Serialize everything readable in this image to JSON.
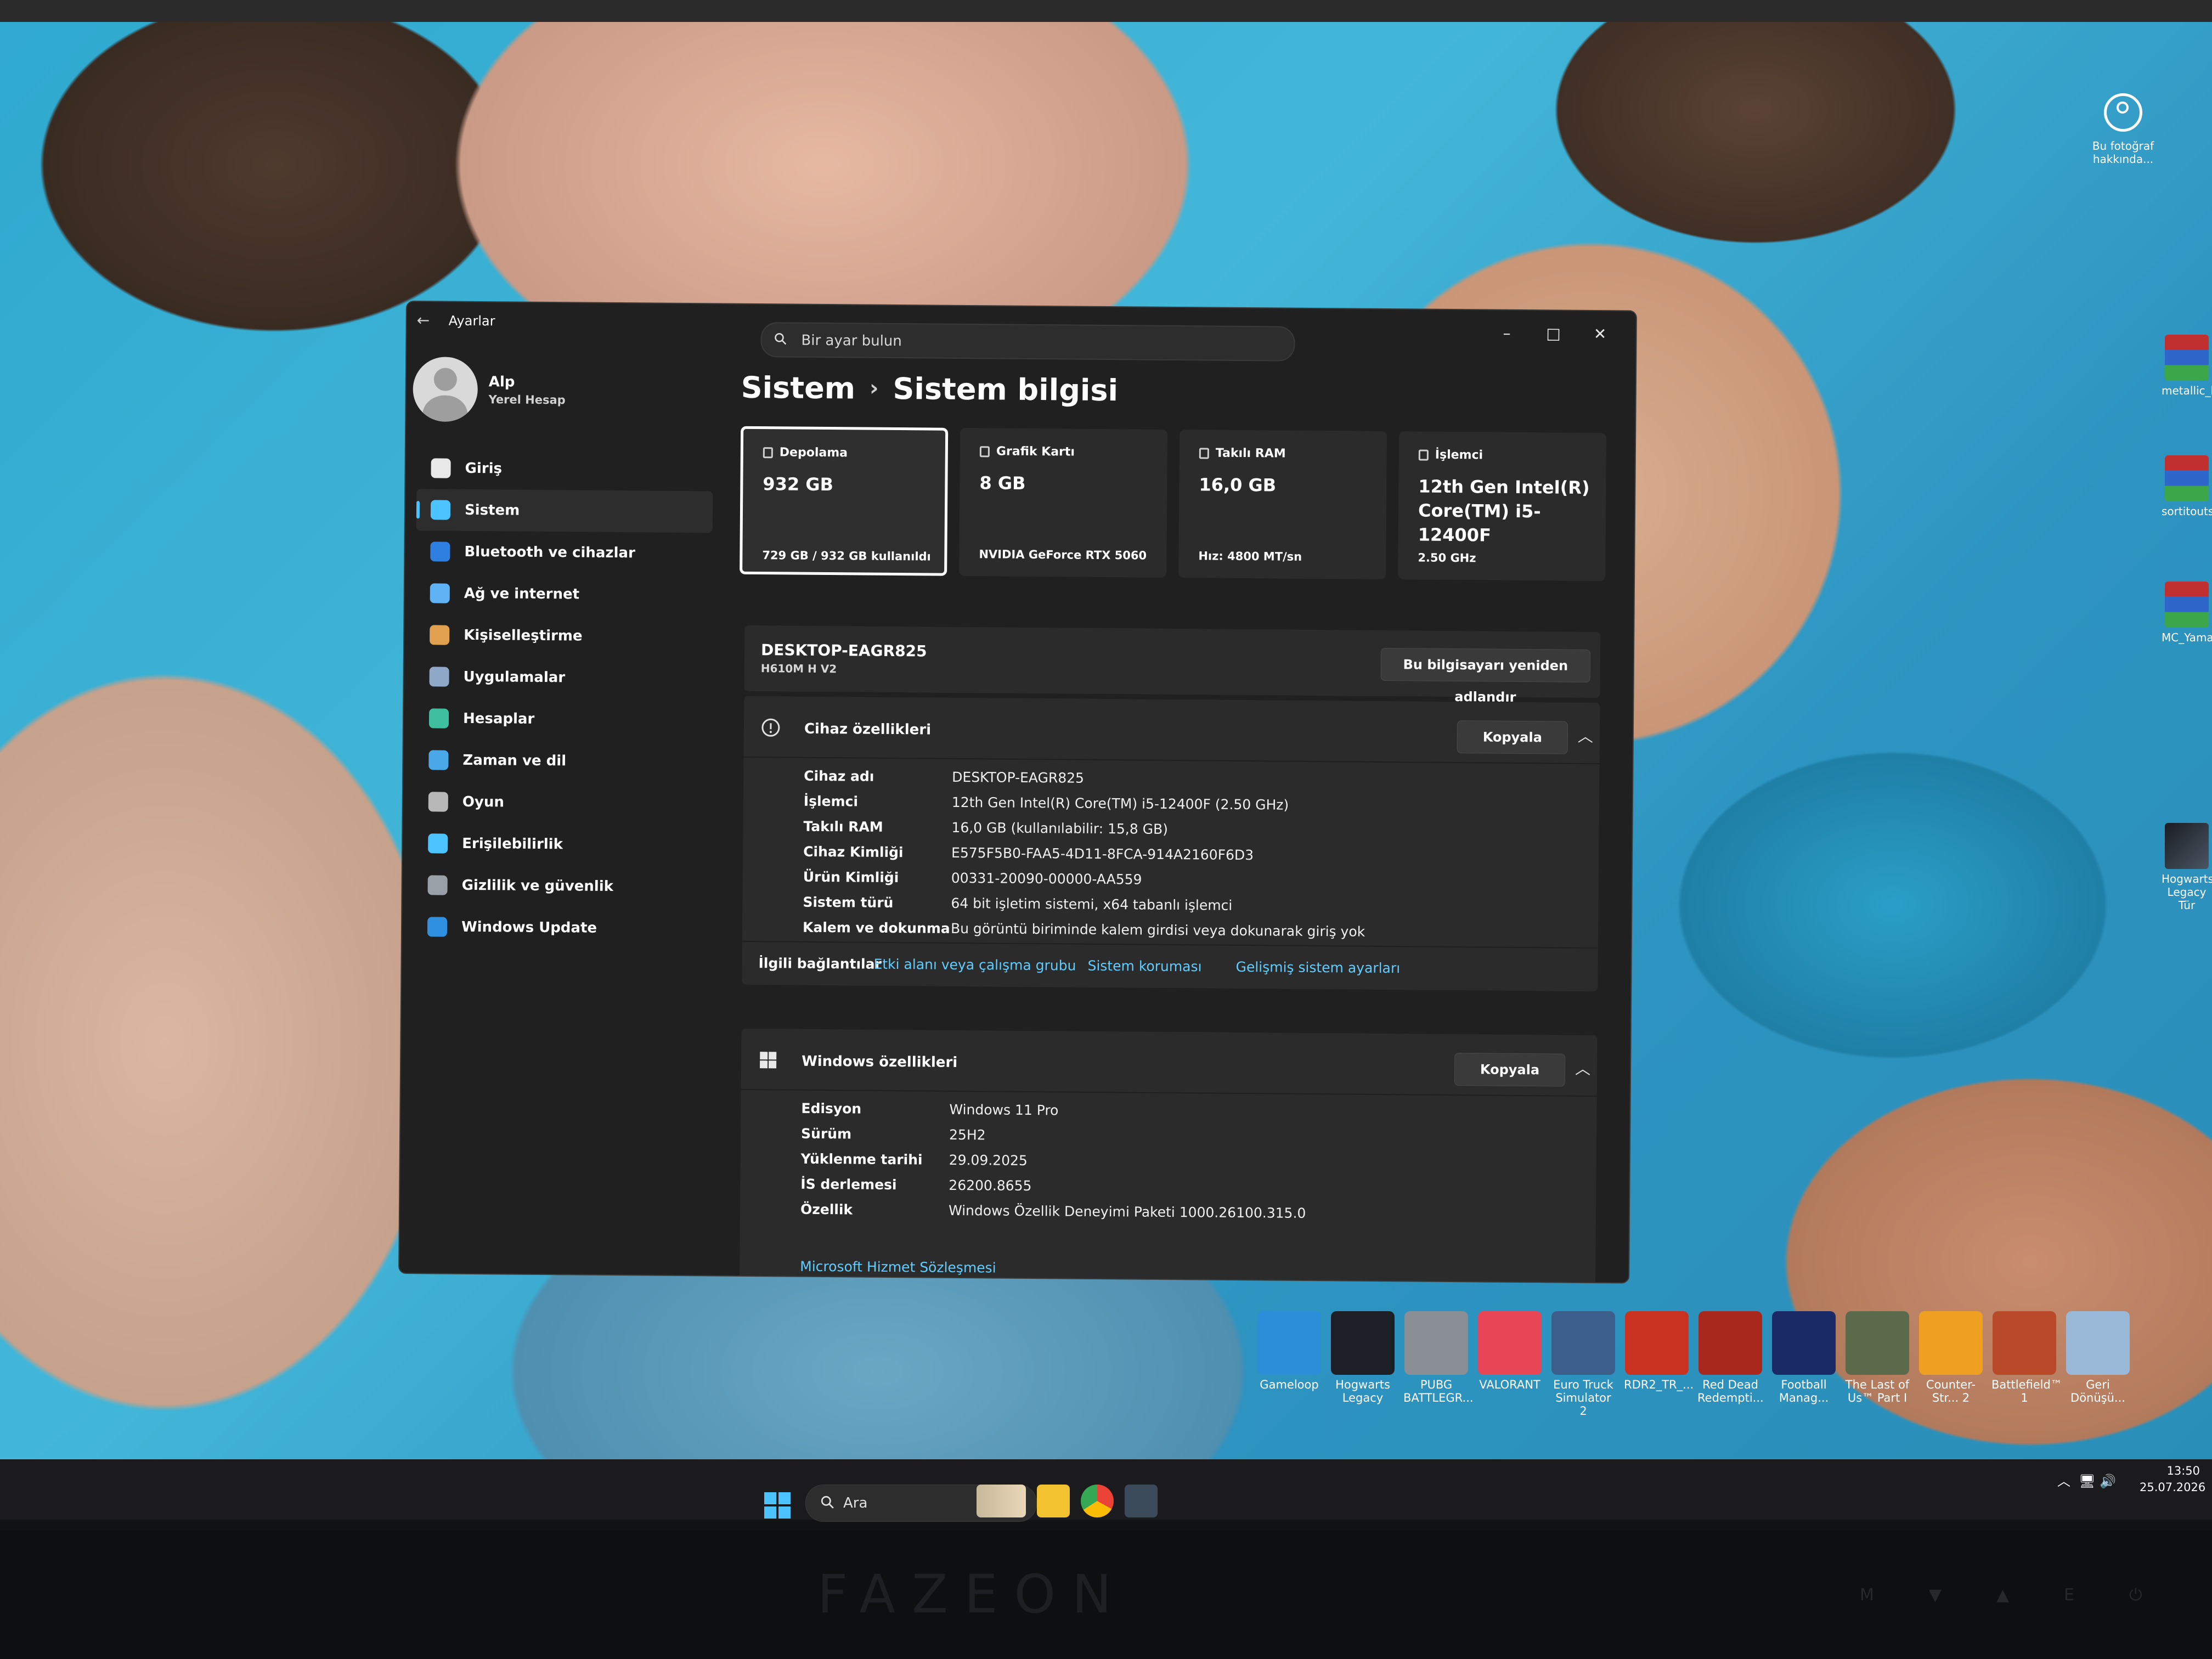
{
  "photo_credit": {
    "label_line1": "Bu fotoğraf",
    "label_line2": "hakkında..."
  },
  "side_icons": [
    {
      "label": "metallic_l",
      "icon": "winrar-archive-icon"
    },
    {
      "label": "sortitouts",
      "icon": "winrar-archive-icon"
    },
    {
      "label": "MC_Yama",
      "icon": "winrar-archive-icon"
    },
    {
      "label": "Hogwarts Legacy Tür",
      "icon": "hogwarts-legacy-icon"
    }
  ],
  "window": {
    "app_title": "Ayarlar",
    "search_placeholder": "Bir ayar bulun",
    "user": {
      "name": "Alp",
      "type": "Yerel Hesap"
    },
    "nav": [
      {
        "label": "Giriş",
        "icon": "home-icon",
        "color": "#e8e8e8",
        "active": false
      },
      {
        "label": "Sistem",
        "icon": "system-monitor-icon",
        "color": "#4cc2ff",
        "active": true
      },
      {
        "label": "Bluetooth ve cihazlar",
        "icon": "bluetooth-icon",
        "color": "#2f7fe0",
        "active": false
      },
      {
        "label": "Ağ ve internet",
        "icon": "wifi-icon",
        "color": "#5fb3f5",
        "active": false
      },
      {
        "label": "Kişiselleştirme",
        "icon": "brush-icon",
        "color": "#e0a050",
        "active": false
      },
      {
        "label": "Uygulamalar",
        "icon": "apps-icon",
        "color": "#8fa8c8",
        "active": false
      },
      {
        "label": "Hesaplar",
        "icon": "person-icon",
        "color": "#3fbf9f",
        "active": false
      },
      {
        "label": "Zaman ve dil",
        "icon": "globe-clock-icon",
        "color": "#4aa8e8",
        "active": false
      },
      {
        "label": "Oyun",
        "icon": "gamepad-icon",
        "color": "#b8b8b8",
        "active": false
      },
      {
        "label": "Erişilebilirlik",
        "icon": "accessibility-icon",
        "color": "#4cc2ff",
        "active": false
      },
      {
        "label": "Gizlilik ve güvenlik",
        "icon": "shield-icon",
        "color": "#9aa0a8",
        "active": false
      },
      {
        "label": "Windows Update",
        "icon": "update-icon",
        "color": "#2f8fe0",
        "active": false
      }
    ],
    "breadcrumb": {
      "parent": "Sistem",
      "current": "Sistem bilgisi"
    },
    "cards": [
      {
        "title": "Depolama",
        "value": "932 GB",
        "sub": "729 GB / 932 GB kullanıldı",
        "icon": "storage-icon",
        "selected": true
      },
      {
        "title": "Grafik Kartı",
        "value": "8 GB",
        "sub": "NVIDIA GeForce RTX 5060",
        "icon": "gpu-icon",
        "selected": false
      },
      {
        "title": "Takılı RAM",
        "value": "16,0 GB",
        "sub": "Hız: 4800 MT/sn",
        "icon": "ram-icon",
        "selected": false
      },
      {
        "title": "İşlemci",
        "value": "12th Gen Intel(R) Core(TM) i5-12400F",
        "sub": "2.50 GHz",
        "icon": "cpu-icon",
        "selected": false
      }
    ],
    "device": {
      "name": "DESKTOP-EAGR825",
      "model": "H610M H V2",
      "rename_label": "Bu bilgisayarı yeniden adlandır"
    },
    "device_specs": {
      "title": "Cihaz özellikleri",
      "copy_label": "Kopyala",
      "rows": [
        {
          "key": "Cihaz adı",
          "value": "DESKTOP-EAGR825"
        },
        {
          "key": "İşlemci",
          "value": "12th Gen Intel(R) Core(TM) i5-12400F (2.50 GHz)"
        },
        {
          "key": "Takılı RAM",
          "value": "16,0 GB (kullanılabilir: 15,8 GB)"
        },
        {
          "key": "Cihaz Kimliği",
          "value": "E575F5B0-FAA5-4D11-8FCA-914A2160F6D3"
        },
        {
          "key": "Ürün Kimliği",
          "value": "00331-20090-00000-AA559"
        },
        {
          "key": "Sistem türü",
          "value": "64 bit işletim sistemi, x64 tabanlı işlemci"
        },
        {
          "key": "Kalem ve dokunma",
          "value": "Bu görüntü biriminde kalem girdisi veya dokunarak giriş yok"
        }
      ],
      "related_label": "İlgili bağlantılar",
      "related_links": [
        "Etki alanı veya çalışma grubu",
        "Sistem koruması",
        "Gelişmiş sistem ayarları"
      ]
    },
    "windows_specs": {
      "title": "Windows özellikleri",
      "copy_label": "Kopyala",
      "rows": [
        {
          "key": "Edisyon",
          "value": "Windows 11 Pro"
        },
        {
          "key": "Sürüm",
          "value": "25H2"
        },
        {
          "key": "Yüklenme tarihi",
          "value": "29.09.2025"
        },
        {
          "key": "İS derlemesi",
          "value": "26200.8655"
        },
        {
          "key": "Özellik",
          "value": "Windows Özellik Deneyimi Paketi 1000.26100.315.0"
        }
      ],
      "ms_link": "Microsoft Hizmet Sözleşmesi"
    }
  },
  "desktop_apps": [
    {
      "label": "Gameloop",
      "color": "#2a8fd8"
    },
    {
      "label": "Hogwarts Legacy",
      "color": "#1c2026"
    },
    {
      "label": "PUBG BATTLEGR...",
      "color": "#8a8f96"
    },
    {
      "label": "VALORANT",
      "color": "#e84557"
    },
    {
      "label": "Euro Truck Simulator 2",
      "color": "#3b5f8a"
    },
    {
      "label": "RDR2_TR_...",
      "color": "#c8321f"
    },
    {
      "label": "Red Dead Redempti...",
      "color": "#a8281e"
    },
    {
      "label": "Football Manag...",
      "color": "#1a2a66"
    },
    {
      "label": "The Last of Us™ Part I",
      "color": "#5a6a4a"
    },
    {
      "label": "Counter-Str... 2",
      "color": "#f0a020"
    },
    {
      "label": "Battlefield™ 1",
      "color": "#b84a2a"
    },
    {
      "label": "Geri Dönüşü...",
      "color": "#9ab8d8"
    }
  ],
  "taskbar": {
    "search_label": "Ara",
    "time": "13:50",
    "date": "25.07.2026"
  },
  "monitor": {
    "brand": "FAZEON",
    "buttons": [
      "M",
      "▼",
      "▲",
      "E",
      "⏻"
    ]
  }
}
